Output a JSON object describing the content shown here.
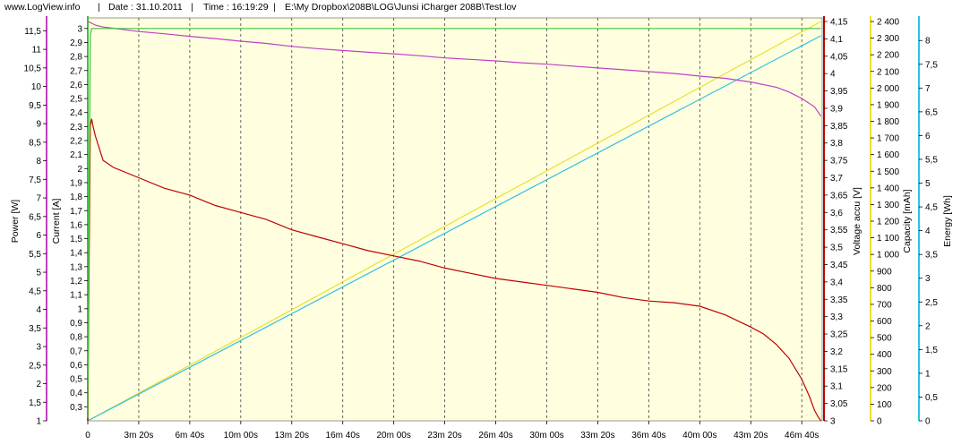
{
  "header": {
    "site": "www.LogView.info",
    "sep": "|",
    "date": "Date : 31.10.2011",
    "time": "Time : 16:19:29",
    "path": "E:\\My Dropbox\\208B\\LOG\\Junsi iCharger 208B\\Test.lov"
  },
  "colors": {
    "plot_bg": "#ffffe0",
    "power": "#c040c0",
    "current": "#40c040",
    "voltage": "#c00000",
    "capacity": "#e8e030",
    "energy": "#30c0e0",
    "gridline": "#404040"
  },
  "chart_data": {
    "type": "line",
    "grid": true,
    "x_unit": "s",
    "xlim": [
      0,
      2880
    ],
    "x_ticks": [
      {
        "v": 0,
        "label": "0"
      },
      {
        "v": 200,
        "label": "3m 20s"
      },
      {
        "v": 400,
        "label": "6m 40s"
      },
      {
        "v": 600,
        "label": "10m 00s"
      },
      {
        "v": 800,
        "label": "13m 20s"
      },
      {
        "v": 1000,
        "label": "16m 40s"
      },
      {
        "v": 1200,
        "label": "20m 00s"
      },
      {
        "v": 1400,
        "label": "23m 20s"
      },
      {
        "v": 1600,
        "label": "26m 40s"
      },
      {
        "v": 1800,
        "label": "30m 00s"
      },
      {
        "v": 2000,
        "label": "33m 20s"
      },
      {
        "v": 2200,
        "label": "36m 40s"
      },
      {
        "v": 2400,
        "label": "40m 00s"
      },
      {
        "v": 2600,
        "label": "43m 20s"
      },
      {
        "v": 2800,
        "label": "46m 40s"
      }
    ],
    "axes": [
      {
        "id": "power",
        "label": "Power [W]",
        "color": "power",
        "side": "left",
        "min": 1,
        "max": 11.75,
        "ticks": [
          "1",
          "1,5",
          "2",
          "2,5",
          "3",
          "3,5",
          "4",
          "4,5",
          "5",
          "5,5",
          "6",
          "6,5",
          "7",
          "7,5",
          "8",
          "8,5",
          "9",
          "9,5",
          "10",
          "10,5",
          "11",
          "11,5"
        ]
      },
      {
        "id": "current",
        "label": "Current [A]",
        "color": "current",
        "side": "left",
        "min": 0.2,
        "max": 3.05,
        "ticks": [
          "0,3",
          "0,4",
          "0,5",
          "0,6",
          "0,7",
          "0,8",
          "0,9",
          "1",
          "1,1",
          "1,2",
          "1,3",
          "1,4",
          "1,5",
          "1,6",
          "1,7",
          "1,8",
          "1,9",
          "2",
          "2,1",
          "2,2",
          "2,3",
          "2,4",
          "2,5",
          "2,6",
          "2,7",
          "2,8",
          "2,9",
          "3"
        ]
      },
      {
        "id": "voltage",
        "label": "Voltage accu [V]",
        "color": "voltage",
        "side": "right",
        "min": 3.0,
        "max": 4.15,
        "ticks": [
          "3",
          "3,05",
          "3,1",
          "3,15",
          "3,2",
          "3,25",
          "3,3",
          "3,35",
          "3,4",
          "3,45",
          "3,5",
          "3,55",
          "3,6",
          "3,65",
          "3,7",
          "3,75",
          "3,8",
          "3,85",
          "3,9",
          "3,95",
          "4",
          "4,05",
          "4,1",
          "4,15"
        ]
      },
      {
        "id": "capacity",
        "label": "Capacity [mAh]",
        "color": "capacity",
        "side": "right",
        "min": 0,
        "max": 2400,
        "ticks": [
          "0",
          "100",
          "200",
          "300",
          "400",
          "500",
          "600",
          "700",
          "800",
          "900",
          "1 000",
          "1 100",
          "1 200",
          "1 300",
          "1 400",
          "1 500",
          "1 600",
          "1 700",
          "1 800",
          "1 900",
          "2 000",
          "2 100",
          "2 200",
          "2 300",
          "2 400"
        ]
      },
      {
        "id": "energy",
        "label": "Energy [Wh]",
        "color": "energy",
        "side": "right",
        "min": 0,
        "max": 8.4,
        "ticks": [
          "0",
          "0,5",
          "1",
          "1,5",
          "2",
          "2,5",
          "3",
          "3,5",
          "4",
          "4,5",
          "5",
          "5,5",
          "6",
          "6,5",
          "7",
          "7,5",
          "8"
        ]
      }
    ],
    "series": [
      {
        "name": "Power [W]",
        "axis": "power",
        "color": "power",
        "x": [
          0,
          10,
          30,
          60,
          120,
          200,
          300,
          400,
          500,
          600,
          700,
          800,
          900,
          1000,
          1100,
          1200,
          1300,
          1400,
          1500,
          1600,
          1700,
          1800,
          1900,
          2000,
          2100,
          2200,
          2300,
          2400,
          2500,
          2600,
          2700,
          2750,
          2800,
          2850,
          2875
        ],
        "y": [
          11.75,
          11.72,
          11.65,
          11.6,
          11.55,
          11.48,
          11.42,
          11.35,
          11.29,
          11.22,
          11.16,
          11.08,
          11.02,
          10.97,
          10.92,
          10.88,
          10.83,
          10.77,
          10.73,
          10.69,
          10.64,
          10.6,
          10.55,
          10.5,
          10.45,
          10.4,
          10.35,
          10.28,
          10.22,
          10.12,
          9.98,
          9.85,
          9.68,
          9.45,
          9.2
        ]
      },
      {
        "name": "Current [A]",
        "axis": "current",
        "color": "current",
        "x": [
          0,
          10,
          15,
          30,
          100,
          500,
          1000,
          1500,
          2000,
          2500,
          2875
        ],
        "y": [
          0.22,
          2.95,
          3.0,
          3.0,
          3.0,
          3.0,
          3.0,
          3.0,
          3.0,
          3.0,
          3.0
        ]
      },
      {
        "name": "Voltage accu [V]",
        "axis": "voltage",
        "color": "voltage",
        "x": [
          0,
          10,
          15,
          20,
          30,
          60,
          100,
          200,
          300,
          400,
          500,
          600,
          700,
          800,
          900,
          1000,
          1100,
          1200,
          1300,
          1400,
          1500,
          1600,
          1700,
          1800,
          1900,
          2000,
          2100,
          2200,
          2300,
          2400,
          2500,
          2600,
          2650,
          2700,
          2750,
          2800,
          2830,
          2850,
          2865,
          2875
        ],
        "y": [
          3.0,
          3.85,
          3.87,
          3.85,
          3.82,
          3.75,
          3.73,
          3.7,
          3.67,
          3.65,
          3.62,
          3.6,
          3.58,
          3.55,
          3.53,
          3.51,
          3.49,
          3.475,
          3.46,
          3.44,
          3.425,
          3.41,
          3.4,
          3.39,
          3.38,
          3.37,
          3.355,
          3.345,
          3.34,
          3.33,
          3.305,
          3.27,
          3.25,
          3.22,
          3.18,
          3.12,
          3.07,
          3.03,
          3.01,
          3.0
        ]
      },
      {
        "name": "Capacity [mAh]",
        "axis": "capacity",
        "color": "capacity",
        "x": [
          0,
          2875
        ],
        "y": [
          0,
          2400
        ]
      },
      {
        "name": "Energy [Wh]",
        "axis": "energy",
        "color": "energy",
        "x": [
          0,
          2875
        ],
        "y": [
          0,
          8.1
        ]
      }
    ]
  }
}
